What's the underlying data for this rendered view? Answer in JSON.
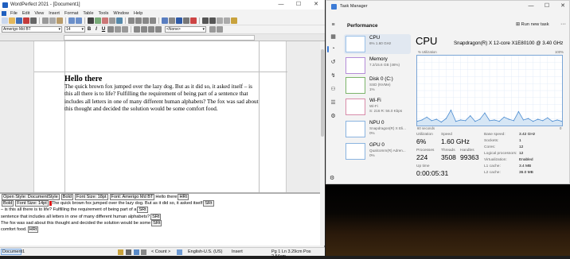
{
  "wordperfect": {
    "title": "WordPerfect 2021 - [Document1]",
    "window_controls": [
      "—",
      "☐",
      "✕"
    ],
    "menu": [
      "File",
      "Edit",
      "View",
      "Insert",
      "Format",
      "Table",
      "Tools",
      "Window",
      "Help"
    ],
    "toolbar3": {
      "font_name": "Amerigo Md BT",
      "font_size": "14",
      "bold": "B",
      "italic": "I",
      "underline": "U",
      "style": "<None>"
    },
    "document": {
      "heading": "Hello there",
      "body": "The quick brown fox jumped over the lazy dog. But as it did so, it asked itself – is this all there is to life? Fulfilling the requirement of being part of a sentence that includes all letters in one of many different human alphabets? The fox was sad about this thought and decided the solution would be some comfort food."
    },
    "reveal_codes": {
      "line1_codes": [
        "Open Style: DocumentStyle",
        "Bold",
        "Font Size: 18pt",
        "Font: Amerigo Md BT",
        "Hello there",
        "HRt"
      ],
      "line2_codes": [
        "Bold",
        "Font Size: 14pt"
      ],
      "line2_text": "The quick brown fox jumped over the lazy dog. But as it did so, it asked itself",
      "line3_text": "– is this all there is to life? Fulfilling the requirement of being part of a",
      "line4_text": "sentence that includes all letters in one of many different human alphabets?",
      "line5_text": "The fox was sad about this thought and decided the solution would be some",
      "line6_text": "comfort food.",
      "srt": "SRt",
      "hrt": "HRt"
    },
    "status": {
      "document": "Document1",
      "count": "< Count >",
      "language": "English-U.S. (US)",
      "mode": "Insert",
      "position": "Pg 1 Ln 3.29cm Pos 2.54cm"
    }
  },
  "task_manager": {
    "title": "Task Manager",
    "window_controls": [
      "—",
      "☐",
      "✕"
    ],
    "section": "Performance",
    "run_new_task": "Run new task",
    "more": "···",
    "resources": [
      {
        "name": "CPU",
        "sub1": "6% 1.60 GHz",
        "sub2": "",
        "selected": true
      },
      {
        "name": "Memory",
        "sub1": "7.2/15.6 GB (46%)",
        "sub2": "",
        "selected": false
      },
      {
        "name": "Disk 0 (C:)",
        "sub1": "SSD (NVMe)",
        "sub2": "1%",
        "selected": false
      },
      {
        "name": "Wi-Fi",
        "sub1": "Wi-Fi",
        "sub2": "S: 216 R: 56.0 Kbps",
        "selected": false
      },
      {
        "name": "NPU 0",
        "sub1": "Snapdragon(R) X Eli...",
        "sub2": "0%",
        "selected": false
      },
      {
        "name": "GPU 0",
        "sub1": "Qualcomm(R) Adren...",
        "sub2": "0%",
        "selected": false
      }
    ],
    "cpu": {
      "heading": "CPU",
      "model": "Snapdragon(R) X 12-core X1E80100 @ 3.40 GHz",
      "util_label": "% Utilization",
      "max_label": "100%",
      "seconds_label": "60 seconds",
      "zero_label": "0",
      "utilization_label": "Utilization",
      "utilization": "6%",
      "speed_label": "Speed",
      "speed": "1.60 GHz",
      "processes_label": "Processes",
      "processes": "224",
      "threads_label": "Threads",
      "threads": "3508",
      "handles_label": "Handles",
      "handles": "99363",
      "uptime_label": "Up time",
      "uptime": "0:00:05:31",
      "details": [
        {
          "k": "Base speed:",
          "v": "3.42 GHz"
        },
        {
          "k": "Sockets:",
          "v": "1"
        },
        {
          "k": "Cores:",
          "v": "12"
        },
        {
          "k": "Logical processors:",
          "v": "12"
        },
        {
          "k": "Virtualization:",
          "v": "Enabled"
        },
        {
          "k": "L1 cache:",
          "v": "3.4 MB"
        },
        {
          "k": "L2 cache:",
          "v": "36.0 MB"
        }
      ]
    }
  },
  "chart_data": {
    "type": "area",
    "xlabel": "60 seconds",
    "ylabel": "% Utilization",
    "ylim": [
      0,
      100
    ],
    "x": [
      0,
      2,
      4,
      6,
      8,
      10,
      12,
      14,
      16,
      18,
      20,
      22,
      24,
      26,
      28,
      30,
      32,
      34,
      36,
      38,
      40,
      42,
      44,
      46,
      48,
      50,
      52,
      54,
      56,
      58,
      60
    ],
    "values": [
      6,
      8,
      12,
      7,
      9,
      5,
      10,
      22,
      6,
      8,
      7,
      14,
      6,
      9,
      18,
      7,
      8,
      6,
      12,
      9,
      7,
      20,
      8,
      10,
      6,
      9,
      7,
      11,
      6,
      8,
      6
    ],
    "grid": true
  },
  "colors": {
    "accent": "#3c7bd6",
    "cpu_line": "#4a8bd0",
    "cpu_fill": "#d6e6f5"
  }
}
